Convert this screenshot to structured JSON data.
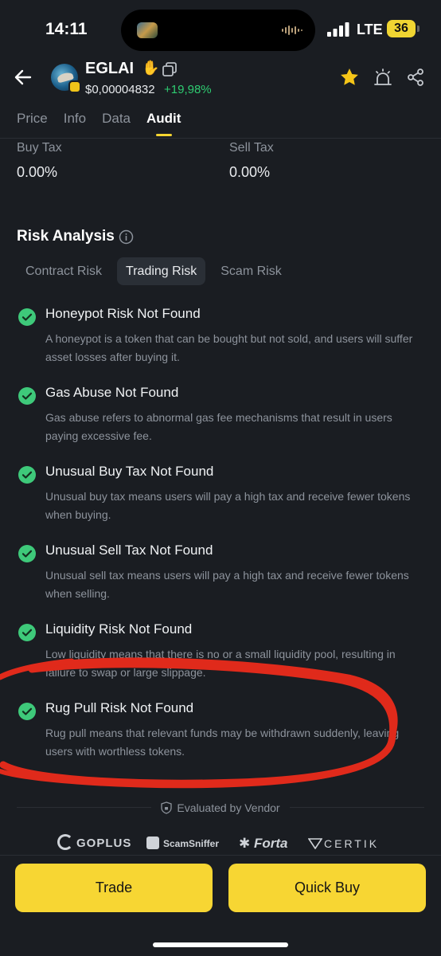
{
  "status_bar": {
    "time": "14:11",
    "network": "LTE",
    "battery": "36"
  },
  "token": {
    "name": "EGLAI",
    "price": "$0,00004832",
    "change": "+19,98%"
  },
  "tabs": [
    {
      "label": "Price"
    },
    {
      "label": "Info"
    },
    {
      "label": "Data"
    },
    {
      "label": "Audit"
    }
  ],
  "taxes": {
    "buy_label": "Buy Tax",
    "buy_value": "0.00%",
    "sell_label": "Sell Tax",
    "sell_value": "0.00%"
  },
  "risk_analysis": {
    "title": "Risk Analysis",
    "tabs": [
      {
        "label": "Contract Risk"
      },
      {
        "label": "Trading Risk"
      },
      {
        "label": "Scam Risk"
      }
    ],
    "items": [
      {
        "title": "Honeypot Risk Not Found",
        "desc": "A honeypot is a token that can be bought but not sold, and users will suffer asset losses after buying it."
      },
      {
        "title": "Gas Abuse Not Found",
        "desc": "Gas abuse refers to abnormal gas fee mechanisms that result in users paying excessive fee."
      },
      {
        "title": "Unusual Buy Tax Not Found",
        "desc": "Unusual buy tax means users will pay a high tax and receive fewer tokens when buying."
      },
      {
        "title": "Unusual Sell Tax Not Found",
        "desc": "Unusual sell tax means users will pay a high tax and receive fewer tokens when selling."
      },
      {
        "title": "Liquidity Risk Not Found",
        "desc": "Low liquidity means that there is no or a small liquidity pool, resulting in failure to swap or large slippage."
      },
      {
        "title": "Rug Pull Risk Not Found",
        "desc": "Rug pull means that relevant funds may be withdrawn suddenly, leaving users with worthless tokens."
      }
    ]
  },
  "vendor": {
    "label": "Evaluated by Vendor",
    "logos": [
      "GOPLUS",
      "ScamSniffer",
      "Forta",
      "CERTIK"
    ]
  },
  "actions": {
    "trade": "Trade",
    "quick_buy": "Quick Buy"
  },
  "colors": {
    "accent": "#f7d633",
    "positive": "#2ecc71",
    "check": "#3ec97a",
    "annotation": "#e02a1b"
  }
}
